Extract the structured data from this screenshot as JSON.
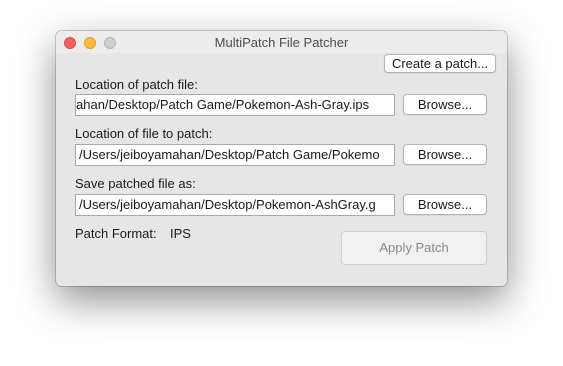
{
  "window": {
    "title": "MultiPatch File Patcher"
  },
  "toolbar": {
    "create_patch_label": "Create a patch..."
  },
  "patch_file": {
    "label": "Location of patch file:",
    "value": "ahan/Desktop/Patch Game/Pokemon-Ash-Gray.ips",
    "browse_label": "Browse..."
  },
  "target_file": {
    "label": "Location of file to patch:",
    "value": "/Users/jeiboyamahan/Desktop/Patch Game/Pokemo",
    "browse_label": "Browse..."
  },
  "output_file": {
    "label": "Save patched file as:",
    "value": "/Users/jeiboyamahan/Desktop/Pokemon-AshGray.g",
    "browse_label": "Browse..."
  },
  "format": {
    "label": "Patch Format:",
    "value": "IPS"
  },
  "actions": {
    "apply_label": "Apply Patch"
  },
  "colors": {
    "close": "#fc605c",
    "minimize": "#fdbc40",
    "zoom_disabled": "#d0d0d0",
    "window_bg": "#e6e6e6"
  }
}
